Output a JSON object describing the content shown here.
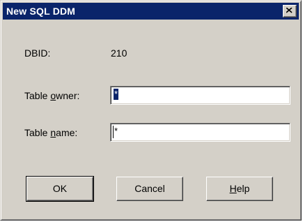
{
  "window": {
    "title": "New SQL DDM",
    "close_icon": "close-icon"
  },
  "dbid": {
    "label": "DBID:",
    "value": "210"
  },
  "table_owner": {
    "label_pre": "Table ",
    "label_accel": "o",
    "label_post": "wner:",
    "value": "*"
  },
  "table_name": {
    "label_pre": "Table ",
    "label_accel": "n",
    "label_post": "ame:",
    "value": "*"
  },
  "buttons": {
    "ok": "OK",
    "cancel": "Cancel",
    "help_accel": "H",
    "help_rest": "elp"
  },
  "colors": {
    "titlebar": "#0a246a",
    "face": "#d4d0c8",
    "selection": "#0a246a"
  }
}
